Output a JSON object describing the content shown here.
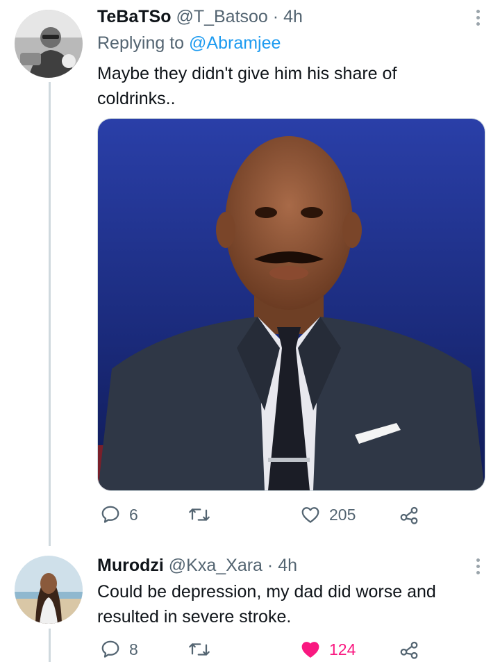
{
  "tweets": [
    {
      "display_name": "TeBaTSo",
      "handle": "@T_Batsoo",
      "time": "4h",
      "replying_prefix": "Replying to",
      "replying_to": "@Abramjee",
      "text_line1": "Maybe they didn't give him his share of",
      "text_line2": "coldrinks..",
      "replies": "6",
      "retweets": "",
      "likes": "205",
      "liked": false,
      "media": "photo of a bald man in a suit",
      "avatar": "black-and-white profile photo"
    },
    {
      "display_name": "Murodzi",
      "handle": "@Kxa_Xara",
      "time": "4h",
      "text_line1": "Could be depression, my dad did worse and",
      "text_line2": "resulted in severe stroke.",
      "replies": "8",
      "retweets": "",
      "likes": "124",
      "liked": true,
      "avatar": "profile photo of woman on beach"
    }
  ],
  "separator": "·",
  "colors": {
    "link": "#1d9bf0",
    "muted": "#536471",
    "like_active": "#f91880",
    "thread_line": "#cfd9de"
  },
  "icons": [
    "reply-icon",
    "retweet-icon",
    "like-icon",
    "share-icon",
    "more-icon"
  ]
}
